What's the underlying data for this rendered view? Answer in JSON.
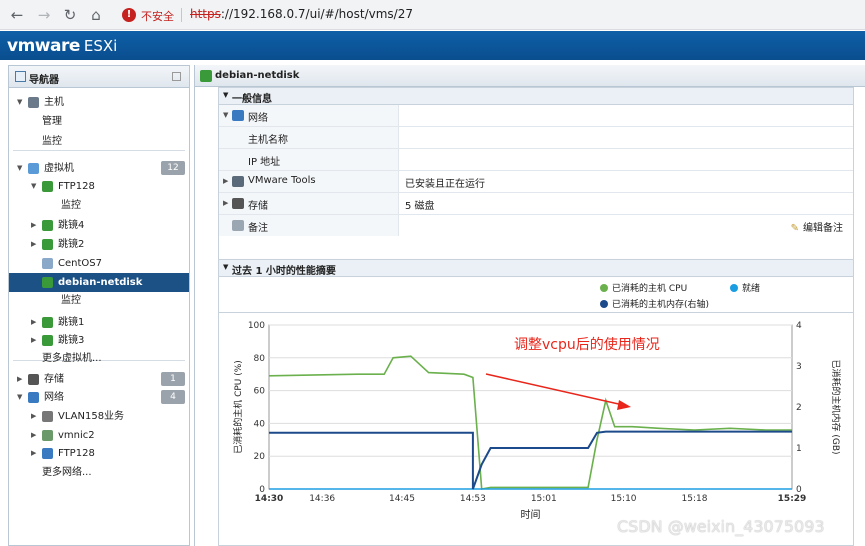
{
  "browser": {
    "insecure_label": "不安全",
    "url_scheme": "https",
    "url_rest": "://192.168.0.7/ui/#/host/vms/27"
  },
  "header": {
    "brand": "vmware",
    "product": "ESXi"
  },
  "navigator": {
    "title": "导航器",
    "items": [
      {
        "label": "主机",
        "level": 0,
        "arrow": "▼",
        "icon": "host-icon"
      },
      {
        "label": "管理",
        "level": 1,
        "arrow": "",
        "icon": ""
      },
      {
        "label": "监控",
        "level": 1,
        "arrow": "",
        "icon": ""
      },
      {
        "label": "虚拟机",
        "level": 0,
        "arrow": "▼",
        "icon": "vm-group-icon",
        "badge": "12"
      },
      {
        "label": "FTP128",
        "level": 1,
        "arrow": "▼",
        "icon": "vm-on-icon"
      },
      {
        "label": "监控",
        "level": 2,
        "arrow": "",
        "icon": ""
      },
      {
        "label": "跳镜4",
        "level": 1,
        "arrow": "▶",
        "icon": "vm-on-icon"
      },
      {
        "label": "跳镜2",
        "level": 1,
        "arrow": "▶",
        "icon": "vm-on-icon"
      },
      {
        "label": "CentOS7",
        "level": 1,
        "arrow": "",
        "icon": "vm-off-icon"
      },
      {
        "label": "debian-netdisk",
        "level": 1,
        "arrow": "",
        "icon": "vm-on-icon",
        "selected": true
      },
      {
        "label": "监控",
        "level": 2,
        "arrow": "",
        "icon": ""
      },
      {
        "label": "跳镜1",
        "level": 1,
        "arrow": "▶",
        "icon": "vm-on-icon"
      },
      {
        "label": "跳镜3",
        "level": 1,
        "arrow": "▶",
        "icon": "vm-on-icon"
      },
      {
        "label": "更多虚拟机...",
        "level": 1,
        "arrow": "",
        "icon": ""
      },
      {
        "label": "存储",
        "level": 0,
        "arrow": "▶",
        "icon": "storage-icon",
        "badge": "1"
      },
      {
        "label": "网络",
        "level": 0,
        "arrow": "▼",
        "icon": "network-icon",
        "badge": "4"
      },
      {
        "label": "VLAN158业务",
        "level": 1,
        "arrow": "▶",
        "icon": "portgroup-icon"
      },
      {
        "label": "vmnic2",
        "level": 1,
        "arrow": "▶",
        "icon": "nic-icon"
      },
      {
        "label": "FTP128",
        "level": 1,
        "arrow": "▶",
        "icon": "network-icon"
      },
      {
        "label": "更多网络...",
        "level": 1,
        "arrow": "",
        "icon": ""
      }
    ]
  },
  "main": {
    "title": "debian-netdisk",
    "general_info": {
      "title": "一般信息",
      "rows": [
        {
          "key": "网络",
          "value": "",
          "arrow": "▼",
          "icon": "network-icon",
          "indent": 0
        },
        {
          "key": "主机名称",
          "value": "",
          "arrow": "",
          "icon": "",
          "indent": 1
        },
        {
          "key": "IP 地址",
          "value": "",
          "arrow": "",
          "icon": "",
          "indent": 1
        },
        {
          "key": "VMware Tools",
          "value": "已安装且正在运行",
          "arrow": "▶",
          "icon": "tools-icon",
          "indent": 0
        },
        {
          "key": "存储",
          "value": "5 磁盘",
          "arrow": "▶",
          "icon": "storage-icon",
          "indent": 0
        },
        {
          "key": "备注",
          "value": "",
          "arrow": "",
          "icon": "notes-icon",
          "indent": 0
        }
      ],
      "edit_notes_label": "编辑备注"
    },
    "performance": {
      "title": "过去 1 小时的性能摘要"
    }
  },
  "chart_data": {
    "type": "line",
    "annotation": "调整vcpu后的使用情况",
    "xlabel": "时间",
    "ylabel": "已消耗的主机 CPU (%)",
    "y2label": "已消耗的主机内存 (GB)",
    "ylim": [
      0,
      100
    ],
    "y2lim": [
      0,
      4
    ],
    "yticks": [
      "100",
      "80",
      "60",
      "40",
      "20",
      "0"
    ],
    "y2ticks": [
      "4",
      "3",
      "2",
      "1",
      "0"
    ],
    "xticks": [
      "14:30",
      "14:36",
      "14:45",
      "14:53",
      "15:01",
      "15:10",
      "15:18",
      "15:29"
    ],
    "x_range": [
      "14:30",
      "15:29"
    ],
    "legend": [
      "已消耗的主机 CPU",
      "就绪",
      "已消耗的主机内存(右轴)"
    ],
    "series": [
      {
        "name": "已消耗的主机 CPU",
        "color": "#6ab04c",
        "axis": "left",
        "x": [
          "14:30",
          "14:40",
          "14:43",
          "14:44",
          "14:46",
          "14:48",
          "14:52",
          "14:53",
          "14:54",
          "14:55",
          "15:00",
          "15:06",
          "15:07",
          "15:08",
          "15:09",
          "15:11",
          "15:14",
          "15:18",
          "15:22",
          "15:26",
          "15:29"
        ],
        "values": [
          69,
          70,
          70,
          80,
          81,
          71,
          70,
          68,
          0,
          1,
          1,
          1,
          30,
          54,
          38,
          38,
          37,
          36,
          37,
          36,
          36
        ]
      },
      {
        "name": "就绪",
        "color": "#1b9de2",
        "axis": "left",
        "x": [
          "14:30",
          "15:29"
        ],
        "values": [
          0,
          0
        ]
      },
      {
        "name": "已消耗的主机内存(右轴)",
        "color": "#1c4a8a",
        "axis": "right",
        "x": [
          "14:30",
          "14:53",
          "14:53",
          "14:54",
          "14:55",
          "15:06",
          "15:07",
          "15:08",
          "15:29"
        ],
        "values": [
          1.37,
          1.37,
          0,
          0.6,
          1.0,
          1.0,
          1.37,
          1.4,
          1.4
        ]
      }
    ]
  },
  "watermark": "CSDN @weixin_43075093"
}
